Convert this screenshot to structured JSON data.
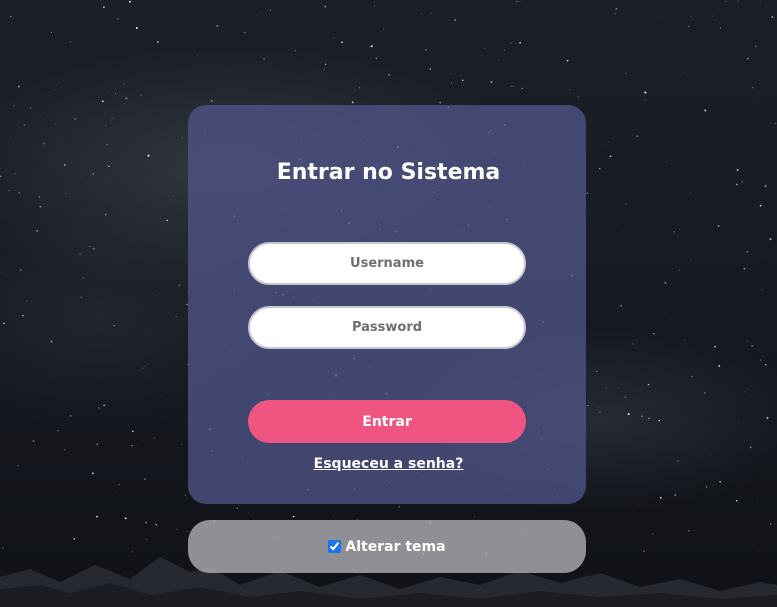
{
  "login": {
    "title": "Entrar no Sistema",
    "username_placeholder": "Username",
    "password_placeholder": "Password",
    "submit_label": "Entrar",
    "forgot_label": "Esqueceu a senha?"
  },
  "theme": {
    "toggle_label": "Alterar tema",
    "checked": true
  },
  "colors": {
    "card": "#4e5587",
    "accent": "#ef5581",
    "theme_bar": "#aaacb2",
    "text": "#ffffff"
  }
}
